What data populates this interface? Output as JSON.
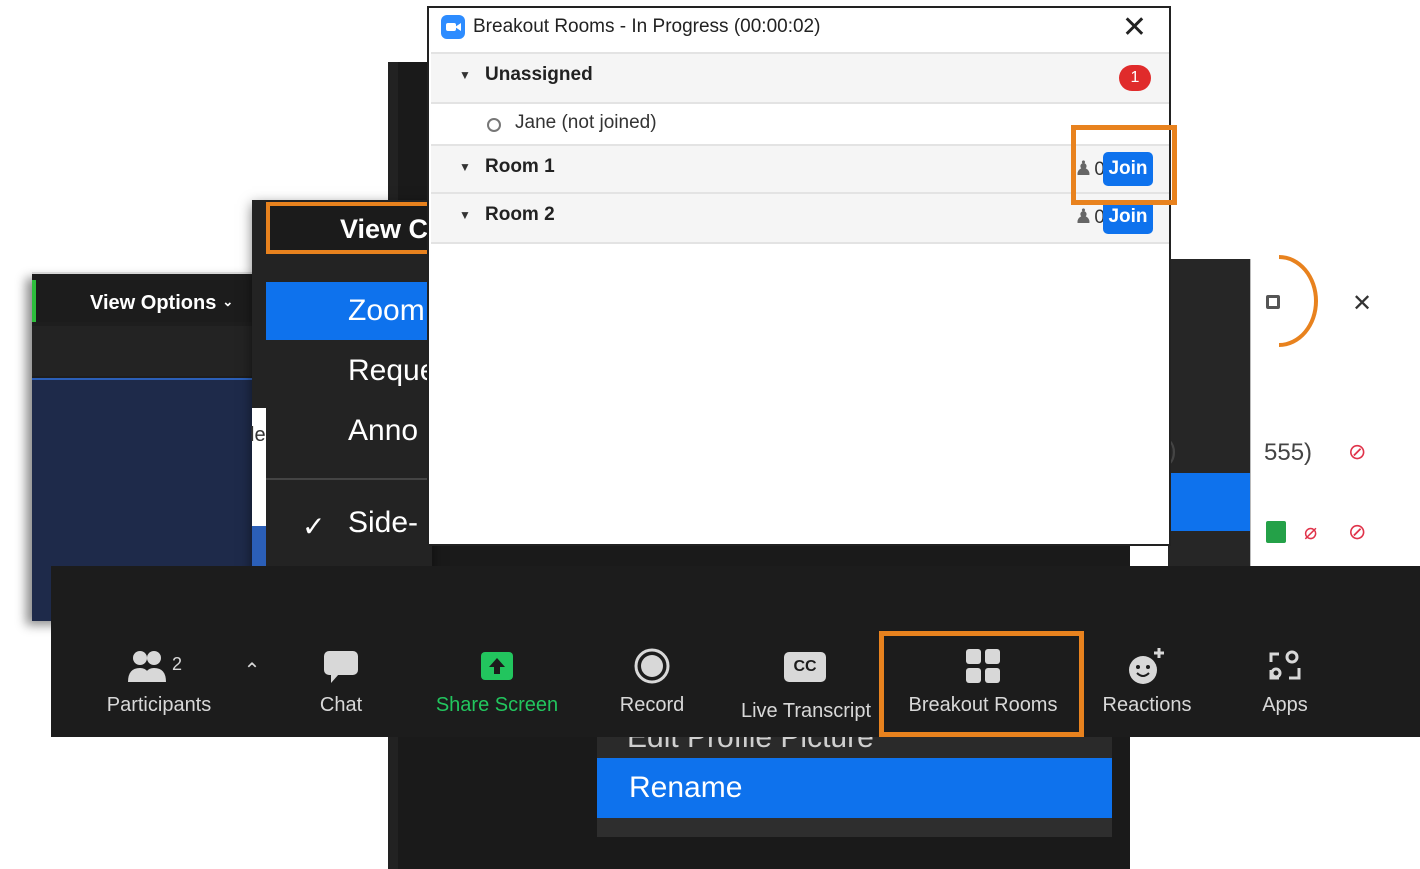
{
  "left_window": {
    "view_options_label": "View Options"
  },
  "view_menu": {
    "header_label": "View C",
    "items": [
      "Zoom",
      "Reque",
      "Anno"
    ],
    "side_label": "Side-",
    "edge_text": "le"
  },
  "participants_window": {
    "number_text": "555)",
    "paren": ")"
  },
  "breakout_dialog": {
    "title": "Breakout Rooms - In Progress (00:00:02)",
    "unassigned": {
      "name": "Unassigned",
      "count": "1"
    },
    "unassigned_members": [
      "Jane (not joined)"
    ],
    "rooms": [
      {
        "name": "Room 1",
        "count": "0",
        "join": "Join"
      },
      {
        "name": "Room 2",
        "count": "0",
        "join": "Join"
      }
    ]
  },
  "toolbar": {
    "participants_label": "Participants",
    "participants_count": "2",
    "chat_label": "Chat",
    "share_label": "Share Screen",
    "record_label": "Record",
    "transcript_label": "Live Transcript",
    "cc_text": "CC",
    "breakout_label": "Breakout Rooms",
    "reactions_label": "Reactions",
    "apps_label": "Apps"
  },
  "context_menu": {
    "cut_off_item": "Edit Profile Picture",
    "rename": "Rename"
  },
  "colors": {
    "accent_blue": "#0e72ed",
    "highlight_orange": "#e8821e",
    "share_green": "#22c55e",
    "badge_red": "#e02b2b"
  }
}
